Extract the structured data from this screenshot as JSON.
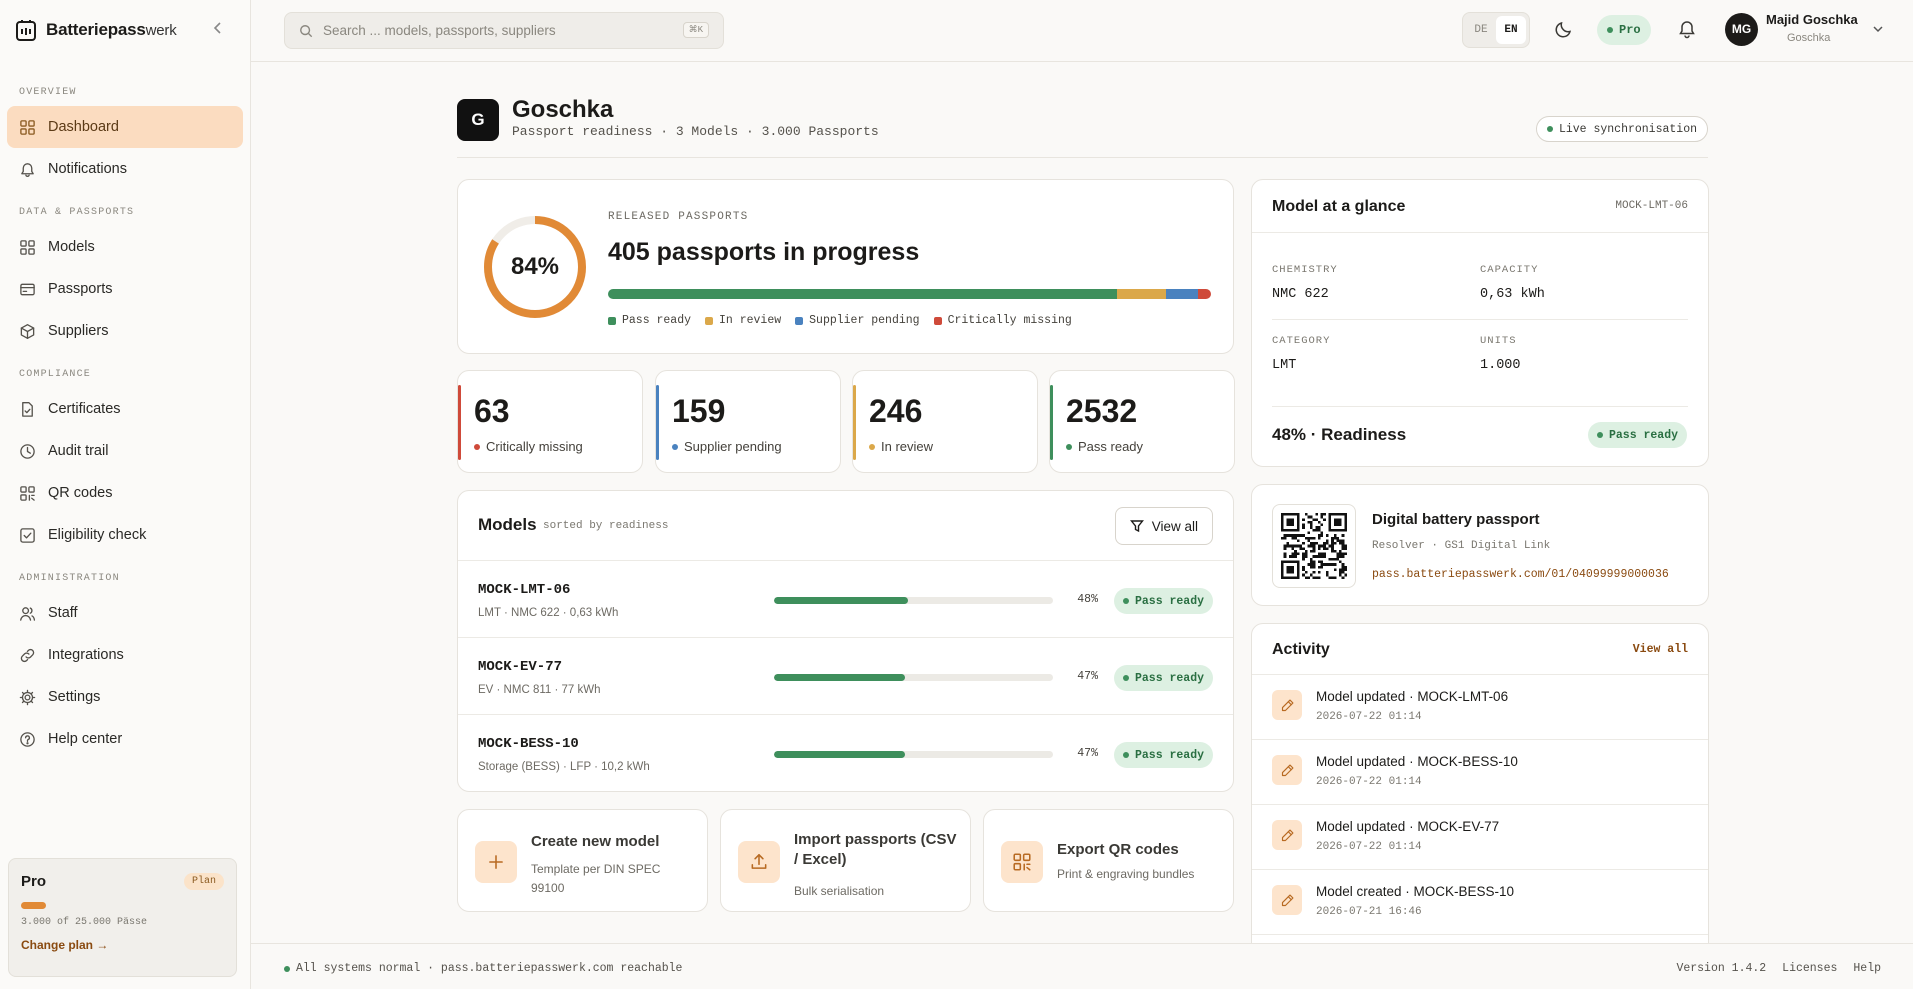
{
  "brand": {
    "name_bold": "Batteriepass",
    "name_light": "werk"
  },
  "search": {
    "placeholder": "Search ... models, passports, suppliers",
    "shortcut": "⌘K"
  },
  "header": {
    "lang_de": "DE",
    "lang_en": "EN",
    "lang_active": "EN",
    "plan_pill": "Pro",
    "user_initials": "MG",
    "user_name": "Majid Goschka",
    "user_org": "Goschka"
  },
  "sidebar": {
    "sections": [
      {
        "title": "OVERVIEW",
        "items": [
          {
            "label": "Dashboard",
            "icon": "grid-icon",
            "active": true
          },
          {
            "label": "Notifications",
            "icon": "bell-icon"
          }
        ]
      },
      {
        "title": "DATA & PASSPORTS",
        "items": [
          {
            "label": "Models",
            "icon": "grid-icon"
          },
          {
            "label": "Passports",
            "icon": "card-icon"
          },
          {
            "label": "Suppliers",
            "icon": "box-icon"
          }
        ]
      },
      {
        "title": "COMPLIANCE",
        "items": [
          {
            "label": "Certificates",
            "icon": "file-check-icon"
          },
          {
            "label": "Audit trail",
            "icon": "clock-icon"
          },
          {
            "label": "QR codes",
            "icon": "qr-icon"
          },
          {
            "label": "Eligibility check",
            "icon": "checkbox-icon"
          }
        ]
      },
      {
        "title": "ADMINISTRATION",
        "items": [
          {
            "label": "Staff",
            "icon": "users-icon"
          },
          {
            "label": "Integrations",
            "icon": "link-icon"
          },
          {
            "label": "Settings",
            "icon": "gear-icon"
          },
          {
            "label": "Help center",
            "icon": "help-icon"
          }
        ]
      }
    ],
    "plan": {
      "name": "Pro",
      "badge": "Plan",
      "usage": "3.000 of 25.000 Pässe",
      "usage_fraction": 0.12,
      "link": "Change plan →"
    }
  },
  "page": {
    "org_initial": "G",
    "org_name": "Goschka",
    "subtitle": "Passport readiness · 3 Models · 3.000 Passports",
    "live": "Live synchronisation"
  },
  "hero": {
    "percent": 84,
    "percent_label": "84%",
    "label": "RELEASED PASSPORTS",
    "title": "405 passports in progress",
    "segments": [
      {
        "label": "Pass ready",
        "value": 2532,
        "color": "#3e8f5c"
      },
      {
        "label": "In review",
        "value": 246,
        "color": "#dba84a"
      },
      {
        "label": "Supplier pending",
        "value": 159,
        "color": "#4a82bf"
      },
      {
        "label": "Critically missing",
        "value": 63,
        "color": "#cf4a3a"
      }
    ]
  },
  "stats": [
    {
      "value": "63",
      "label": "Critically missing",
      "color": "#cf4a3a"
    },
    {
      "value": "159",
      "label": "Supplier pending",
      "color": "#4a82bf"
    },
    {
      "value": "246",
      "label": "In review",
      "color": "#dba84a"
    },
    {
      "value": "2532",
      "label": "Pass ready",
      "color": "#3e8f5c"
    }
  ],
  "models": {
    "title": "Models",
    "subtitle": "sorted by readiness",
    "view_all": "View all",
    "rows": [
      {
        "name": "MOCK-LMT-06",
        "meta": "LMT · NMC 622 · 0,63 kWh",
        "progress": 48,
        "pct": "48%",
        "status": "Pass ready"
      },
      {
        "name": "MOCK-EV-77",
        "meta": "EV · NMC 811 · 77 kWh",
        "progress": 47,
        "pct": "47%",
        "status": "Pass ready"
      },
      {
        "name": "MOCK-BESS-10",
        "meta": "Storage (BESS) · LFP · 10,2 kWh",
        "progress": 47,
        "pct": "47%",
        "status": "Pass ready"
      }
    ]
  },
  "actions": [
    {
      "title": "Create new model",
      "sub": "Template per DIN SPEC 99100",
      "icon": "plus-icon"
    },
    {
      "title": "Import passports (CSV / Excel)",
      "sub": "Bulk serialisation",
      "icon": "upload-icon"
    },
    {
      "title": "Export QR codes",
      "sub": "Print & engraving bundles",
      "icon": "qr-icon"
    }
  ],
  "glance": {
    "title": "Model at a glance",
    "id": "MOCK-LMT-06",
    "chemistry_label": "CHEMISTRY",
    "chemistry": "NMC 622",
    "capacity_label": "CAPACITY",
    "capacity": "0,63 kWh",
    "category_label": "CATEGORY",
    "category": "LMT",
    "units_label": "UNITS",
    "units": "1.000",
    "readiness": "48% · Readiness",
    "status": "Pass ready"
  },
  "passport": {
    "title": "Digital battery passport",
    "sub": "Resolver · GS1 Digital Link",
    "link": "pass.batteriepasswerk.com/01/04099999000036"
  },
  "activity": {
    "title": "Activity",
    "view_all": "View all",
    "items": [
      {
        "text": "Model updated · MOCK-LMT-06",
        "time": "2026-07-22 01:14"
      },
      {
        "text": "Model updated · MOCK-BESS-10",
        "time": "2026-07-22 01:14"
      },
      {
        "text": "Model updated · MOCK-EV-77",
        "time": "2026-07-22 01:14"
      },
      {
        "text": "Model created · MOCK-BESS-10",
        "time": "2026-07-21 16:46"
      }
    ]
  },
  "footer": {
    "status": "All systems normal · pass.batteriepasswerk.com reachable",
    "version": "Version 1.4.2",
    "licenses": "Licenses",
    "help": "Help"
  },
  "colors": {
    "accent": "#e18a36",
    "success": "#3e8f5c",
    "active_nav": "#fbdcc0"
  }
}
